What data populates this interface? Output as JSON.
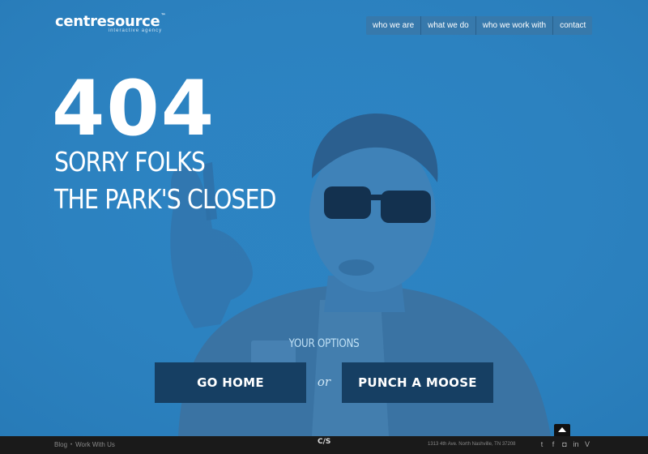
{
  "brand": {
    "name": "centresource",
    "trademark": "™",
    "tagline": "interactive agency"
  },
  "nav": [
    {
      "label": "who we are"
    },
    {
      "label": "what we do"
    },
    {
      "label": "who we work with"
    },
    {
      "label": "contact"
    }
  ],
  "error": {
    "code": "404",
    "line1": "SORRY FOLKS",
    "line2": "THE PARK'S CLOSED"
  },
  "options": {
    "label": "YOUR OPTIONS",
    "home_button": "GO HOME",
    "separator": "or",
    "moose_button": "PUNCH A MOOSE"
  },
  "footer": {
    "links": [
      "Blog",
      "Work With Us"
    ],
    "link_separator": "•",
    "mark": "C/S",
    "address": "1313 4th Ave. North Nashville, TN 37208",
    "socials": [
      {
        "icon": "twitter-icon",
        "glyph": "t"
      },
      {
        "icon": "facebook-icon",
        "glyph": "f"
      },
      {
        "icon": "instagram-icon",
        "glyph": "◘"
      },
      {
        "icon": "linkedin-icon",
        "glyph": "in"
      },
      {
        "icon": "vimeo-icon",
        "glyph": "V"
      }
    ]
  },
  "colors": {
    "background": "#2c83c2",
    "button": "#163f63",
    "footer": "#1a1a1a"
  }
}
